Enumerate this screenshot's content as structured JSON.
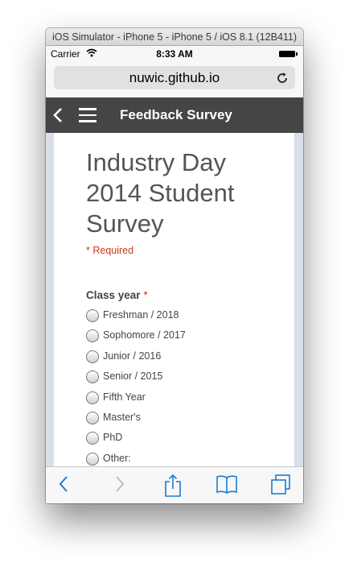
{
  "window": {
    "title": "iOS Simulator - iPhone 5 - iPhone 5 / iOS 8.1 (12B411)"
  },
  "status_bar": {
    "carrier": "Carrier",
    "time": "8:33 AM"
  },
  "address_bar": {
    "url": "nuwic.github.io"
  },
  "app_bar": {
    "title": "Feedback Survey"
  },
  "form": {
    "title": "Industry Day 2014 Student Survey",
    "required_note": "* Required",
    "question": {
      "label": "Class year",
      "required_mark": "*",
      "options": [
        "Freshman / 2018",
        "Sophomore / 2017",
        "Junior / 2016",
        "Senior / 2015",
        "Fifth Year",
        "Master's",
        "PhD",
        "Other:"
      ]
    }
  },
  "icons": {
    "wifi": "wifi-icon",
    "battery": "battery-icon",
    "reload": "reload-icon",
    "back": "back-chevron-icon",
    "menu": "hamburger-menu-icon",
    "safari_back": "safari-back-icon",
    "safari_forward": "safari-forward-icon",
    "share": "share-icon",
    "bookmarks": "bookmarks-icon",
    "tabs": "tabs-icon"
  },
  "colors": {
    "accent": "#1b7dd4",
    "app_bar": "#454545",
    "required": "#c43b1d"
  }
}
